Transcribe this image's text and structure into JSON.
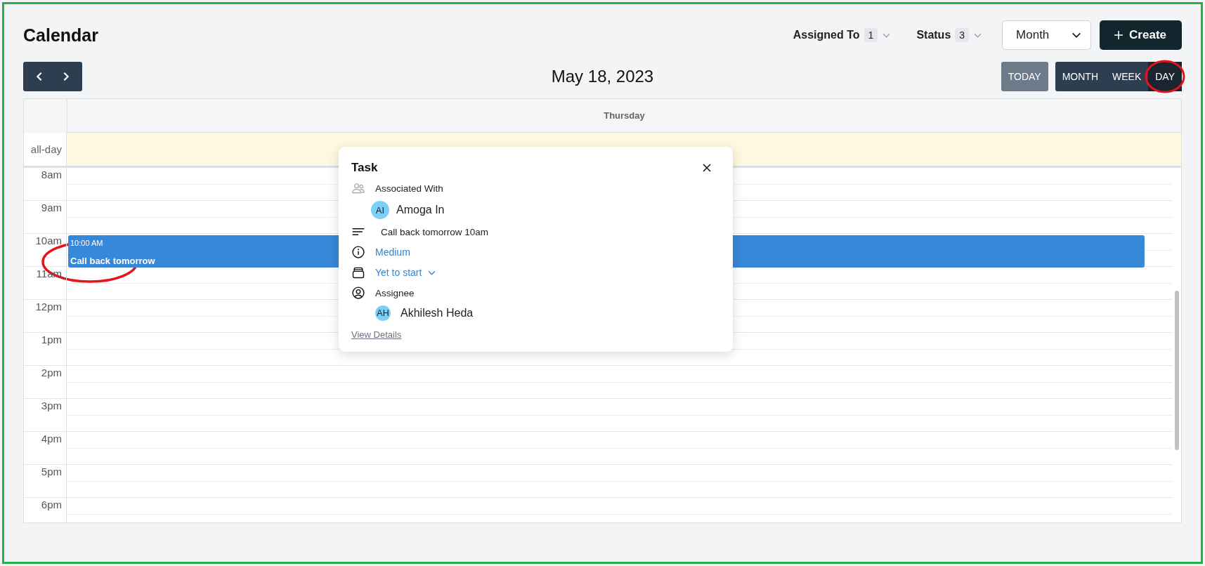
{
  "page_title": "Calendar",
  "filters": [
    {
      "label": "Assigned To",
      "count": "1"
    },
    {
      "label": "Status",
      "count": "3"
    }
  ],
  "view_select": {
    "value": "Month"
  },
  "create_button": {
    "label": "Create"
  },
  "date_title": "May 18, 2023",
  "today_button": {
    "label": "TODAY",
    "disabled": true
  },
  "views": [
    {
      "label": "MONTH",
      "selected": false
    },
    {
      "label": "WEEK",
      "selected": false
    },
    {
      "label": "DAY",
      "selected": true
    }
  ],
  "calendar": {
    "day_header": "Thursday",
    "all_day_label": "all-day",
    "hours": [
      {
        "label": "8am"
      },
      {
        "label": "9am"
      },
      {
        "label": "10am",
        "events": [
          {
            "time": "10:00 AM",
            "title": "Call back tomorrow"
          }
        ]
      },
      {
        "label": "11am"
      },
      {
        "label": "12pm"
      },
      {
        "label": "1pm"
      },
      {
        "label": "2pm"
      },
      {
        "label": "3pm"
      },
      {
        "label": "4pm"
      },
      {
        "label": "5pm"
      },
      {
        "label": "6pm"
      }
    ]
  },
  "popup": {
    "title": "Task",
    "associated_label": "Associated With",
    "associated": {
      "initials": "AI",
      "name": "Amoga In"
    },
    "description": "Call back tomorrow 10am",
    "priority": "Medium",
    "status": "Yet to start",
    "assignee_label": "Assignee",
    "assignee": {
      "initials": "AH",
      "name": "Akhilesh Heda"
    },
    "link": "View Details"
  }
}
